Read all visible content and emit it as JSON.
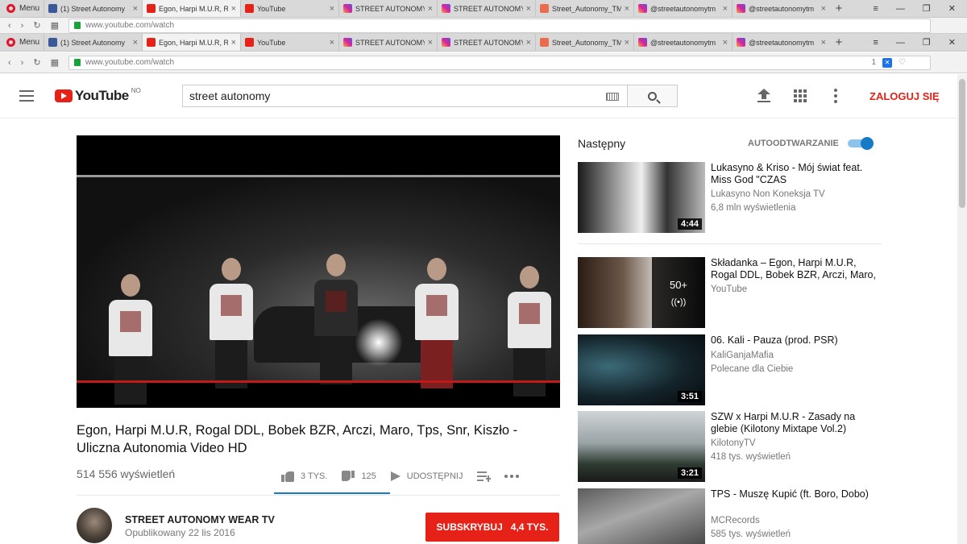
{
  "browser": {
    "menu_label": "Menu",
    "tabs": [
      {
        "label": "(1) Street Autonomy",
        "icon": "facebook-icon"
      },
      {
        "label": "Egon, Harpi M.U.R, R",
        "icon": "youtube-icon"
      },
      {
        "label": "YouTube",
        "icon": "youtube-icon"
      },
      {
        "label": "STREET AUTONOMY",
        "icon": "instagram-icon"
      },
      {
        "label": "STREET AUTONOMY",
        "icon": "instagram-icon"
      },
      {
        "label": "Street_Autonomy_TM",
        "icon": "image-icon"
      },
      {
        "label": "@streetautonomytm",
        "icon": "instagram-icon"
      },
      {
        "label": "@streetautonomytm",
        "icon": "instagram-icon"
      }
    ],
    "url": "www.youtube.com/watch",
    "blocker_count": "1"
  },
  "masthead": {
    "logo_text": "YouTube",
    "country": "NO",
    "search_value": "street autonomy",
    "signin_label": "ZALOGUJ SIĘ"
  },
  "video": {
    "title": "Egon, Harpi M.U.R, Rogal DDL, Bobek BZR, Arczi, Maro, Tps, Snr, Kiszło - Uliczna Autonomia Video HD",
    "views": "514 556 wyświetleń",
    "likes": "3 TYS.",
    "dislikes": "125",
    "share_label": "UDOSTĘPNIJ",
    "like_ratio": 0.96
  },
  "channel": {
    "name": "STREET AUTONOMY WEAR TV",
    "published": "Opublikowany 22 lis 2016",
    "subscribe_label": "SUBSKRYBUJ",
    "subscriber_count": "4,4 TYS."
  },
  "sidebar": {
    "next_label": "Następny",
    "autoplay_label": "AUTOODTWARZANIE",
    "autoplay_on": true,
    "items": [
      {
        "title": "Lukasyno & Kriso - Mój świat feat. Miss God \"CZAS",
        "channel": "Lukasyno Non Koneksja TV",
        "meta": "6,8 mln wyświetlenia",
        "duration": "4:44"
      },
      {
        "title": "Składanka – Egon, Harpi M.U.R, Rogal DDL, Bobek BZR, Arczi, Maro,",
        "channel": "YouTube",
        "meta": "",
        "playlist_count": "50+",
        "playlist_icon": "((•))"
      },
      {
        "title": "06. Kali - Pauza (prod. PSR)",
        "channel": "KaliGanjaMafia",
        "meta": "Polecane dla Ciebie",
        "duration": "3:51"
      },
      {
        "title": "SZW x Harpi M.U.R - Zasady na glebie (Kilotony Mixtape Vol.2)",
        "channel": "KilotonyTV",
        "meta": "418 tys. wyświetleń",
        "duration": "3:21"
      },
      {
        "title": "TPS - Muszę Kupić (ft. Boro, Dobo)",
        "channel": "MCRecords",
        "meta": "585 tys. wyświetleń",
        "duration": ""
      }
    ]
  },
  "colors": {
    "brand_red": "#e62117",
    "accent_blue": "#167ac6"
  }
}
